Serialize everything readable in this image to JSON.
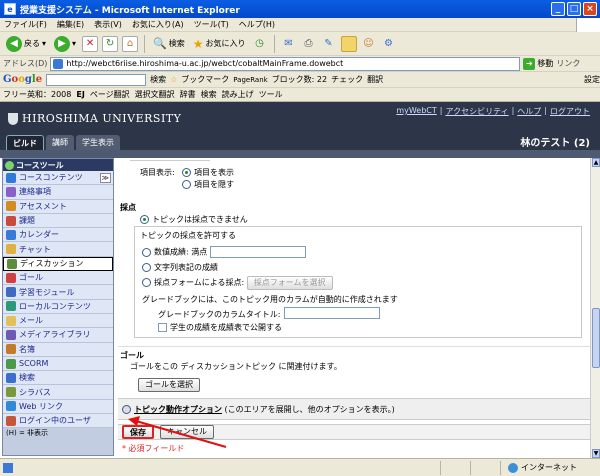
{
  "window": {
    "title": "授業支援システム - Microsoft Internet Explorer",
    "minimize": "_",
    "maximize": "□",
    "close": "×"
  },
  "menu": [
    "ファイル(F)",
    "編集(E)",
    "表示(V)",
    "お気に入り(A)",
    "ツール(T)",
    "ヘルプ(H)"
  ],
  "toolbar": {
    "back": "戻る",
    "search": "検索",
    "favorites": "お気に入り"
  },
  "address": {
    "label": "アドレス(D)",
    "url": "http://webct6riise.hiroshima-u.ac.jp/webct/cobaltMainFrame.dowebct",
    "go": "移動",
    "links": "リンク"
  },
  "google": {
    "logo": [
      "G",
      "o",
      "o",
      "g",
      "l",
      "e"
    ],
    "search_btn": "検索",
    "bookmarks": "ブックマーク",
    "pagerank": "PageRank",
    "blocked": "ブロック数: 22",
    "check": "チェック",
    "translate": "翻訳",
    "settings": "設定"
  },
  "linksbar": [
    "フリー英和：2008",
    "EJ",
    "ページ翻訳",
    "選択文翻訳",
    "辞書",
    "検索",
    "読み上げ",
    "ツール"
  ],
  "banner": {
    "university": "HIROSHIMA UNIVERSITY",
    "toplinks": [
      "myWebCT",
      "アクセシビリティ",
      "ヘルプ",
      "ログアウト"
    ],
    "divider": "|",
    "course": "林のテスト (2)",
    "tabs": [
      "ビルド",
      "講師",
      "学生表示"
    ]
  },
  "sidebar": {
    "header": "コースツール",
    "items": [
      {
        "label": "コースコンテンツ",
        "color": "#2f7bd9"
      },
      {
        "label": "連絡事項",
        "color": "#8a5fc7"
      },
      {
        "label": "アセスメント",
        "color": "#d48b1f"
      },
      {
        "label": "課題",
        "color": "#c94a3a"
      },
      {
        "label": "カレンダー",
        "color": "#3a7ad6"
      },
      {
        "label": "チャット",
        "color": "#e0b040"
      },
      {
        "label": "ディスカッション",
        "color": "#5b8e3d"
      },
      {
        "label": "ゴール",
        "color": "#d04040"
      },
      {
        "label": "学習モジュール",
        "color": "#3f6bc4"
      },
      {
        "label": "ローカルコンテンツ",
        "color": "#2b9a7a"
      },
      {
        "label": "メール",
        "color": "#e2c15a"
      },
      {
        "label": "メディアライブラリ",
        "color": "#6c5bb6"
      },
      {
        "label": "名簿",
        "color": "#c47a2a"
      },
      {
        "label": "SCORM",
        "color": "#4a9a4a"
      },
      {
        "label": "検索",
        "color": "#3a6fcf"
      },
      {
        "label": "シラバス",
        "color": "#7a9a3a"
      },
      {
        "label": "Web リンク",
        "color": "#2f8ad9"
      },
      {
        "label": "ログイン中のユーザ",
        "color": "#c4573a"
      }
    ],
    "footer": "(H) = 非表示",
    "chevron": "≫"
  },
  "form": {
    "item_display_label": "項目表示:",
    "show_item": "項目を表示",
    "hide_item": "項目を隠す",
    "grading_title": "採点",
    "no_grading": "トピックは採点できません",
    "allow_grading": "トピックの採点を許可する",
    "numeric_grade": "数値成績: 満点",
    "text_grade": "文字列表記の成績",
    "form_grade": "採点フォームによる採点:",
    "select_form_btn": "採点フォームを選択",
    "gradebook_note": "グレードブックには、このトピック用のカラムが自動的に作成されます",
    "gradebook_column_label": "グレードブックのカラムタイトル:",
    "publish_grades": "学生の成績を成績表で公開する",
    "goal_title": "ゴール",
    "goal_desc": "ゴールをこの ディスカッショントピック に関連付けます。",
    "select_goal_btn": "ゴールを選択",
    "topic_options_label": "トピック動作オプション",
    "topic_options_hint": "(このエリアを展開し、他のオプションを表示。)",
    "save_btn": "保存",
    "cancel_btn": "キャンセル",
    "required_note": "* 必須フィールド"
  },
  "status": {
    "zone": "インターネット"
  }
}
